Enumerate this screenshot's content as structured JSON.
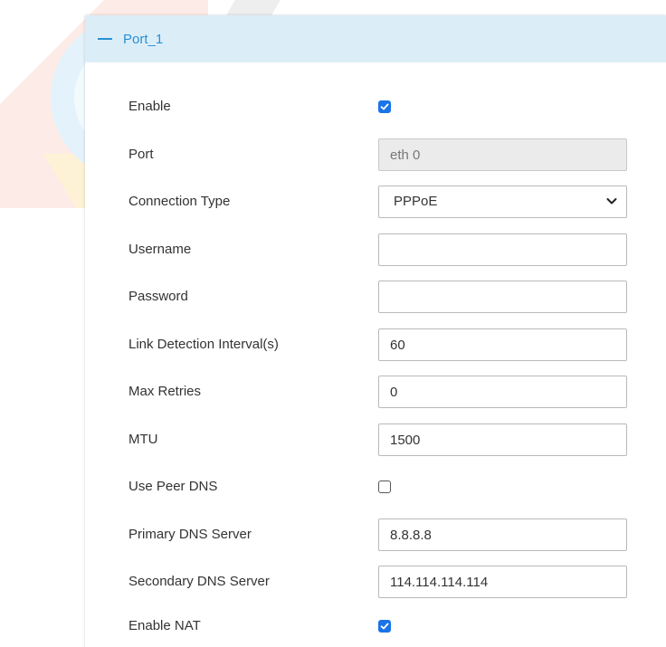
{
  "panel": {
    "title": "Port_1"
  },
  "form": {
    "enable": {
      "label": "Enable",
      "checked": true
    },
    "port": {
      "label": "Port",
      "value": "eth 0"
    },
    "connection_type": {
      "label": "Connection Type",
      "value": "PPPoE"
    },
    "username": {
      "label": "Username",
      "value": ""
    },
    "password": {
      "label": "Password",
      "value": ""
    },
    "link_detection_interval": {
      "label": "Link Detection Interval(s)",
      "value": "60"
    },
    "max_retries": {
      "label": "Max Retries",
      "value": "0"
    },
    "mtu": {
      "label": "MTU",
      "value": "1500"
    },
    "use_peer_dns": {
      "label": "Use Peer DNS",
      "checked": false
    },
    "primary_dns": {
      "label": "Primary DNS Server",
      "value": "8.8.8.8"
    },
    "secondary_dns": {
      "label": "Secondary DNS Server",
      "value": "114.114.114.114"
    },
    "enable_nat": {
      "label": "Enable NAT",
      "checked": true
    }
  },
  "icons": {
    "collapse": "minus-icon",
    "dropdown": "chevron-down-icon",
    "check": "check-icon"
  },
  "colors": {
    "accent": "#2a8fd4",
    "header_bg": "#dbeef8",
    "checkbox": "#1a73e8",
    "disabled_field": "#ebebeb"
  }
}
